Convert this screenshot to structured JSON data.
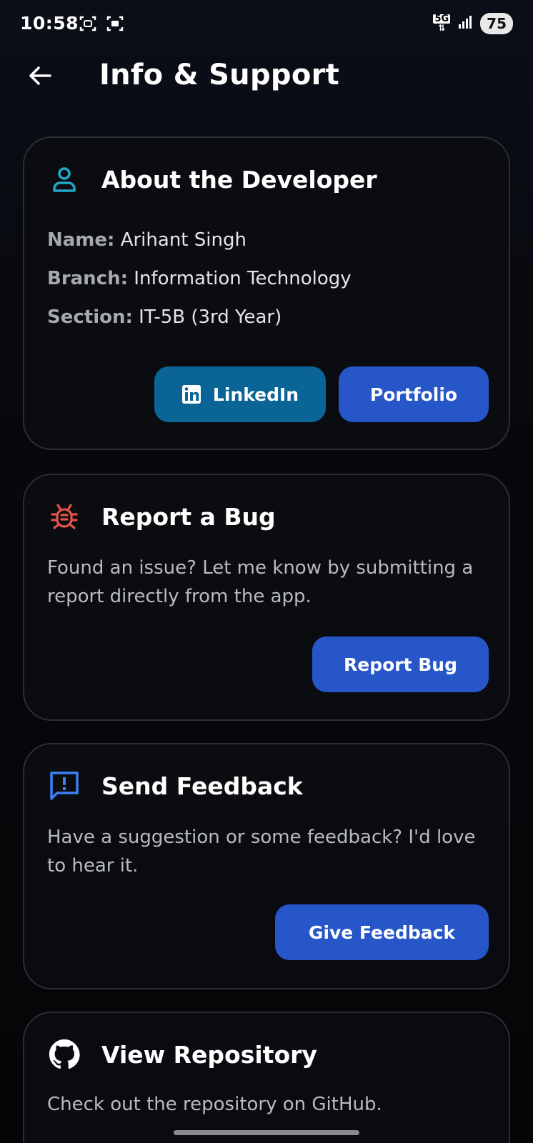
{
  "status_bar": {
    "time": "10:58",
    "network": "5G",
    "battery": "75"
  },
  "header": {
    "title": "Info & Support"
  },
  "about": {
    "title": "About the Developer",
    "name_label": "Name:",
    "name_value": "Arihant Singh",
    "branch_label": "Branch:",
    "branch_value": "Information Technology",
    "section_label": "Section:",
    "section_value": "IT-5B (3rd Year)",
    "linkedin_label": "LinkedIn",
    "portfolio_label": "Portfolio"
  },
  "bug": {
    "title": "Report a Bug",
    "description": "Found an issue? Let me know by submitting a report directly from the app.",
    "button_label": "Report Bug"
  },
  "feedback": {
    "title": "Send Feedback",
    "description": "Have a suggestion or some feedback? I'd love to hear it.",
    "button_label": "Give Feedback"
  },
  "repo": {
    "title": "View Repository",
    "description": "Check out the repository on GitHub."
  },
  "colors": {
    "accent_blue": "#2756c9",
    "linkedin_blue": "#0a6495",
    "bug_red": "#e5534b",
    "person_teal": "#1fa9c8"
  }
}
